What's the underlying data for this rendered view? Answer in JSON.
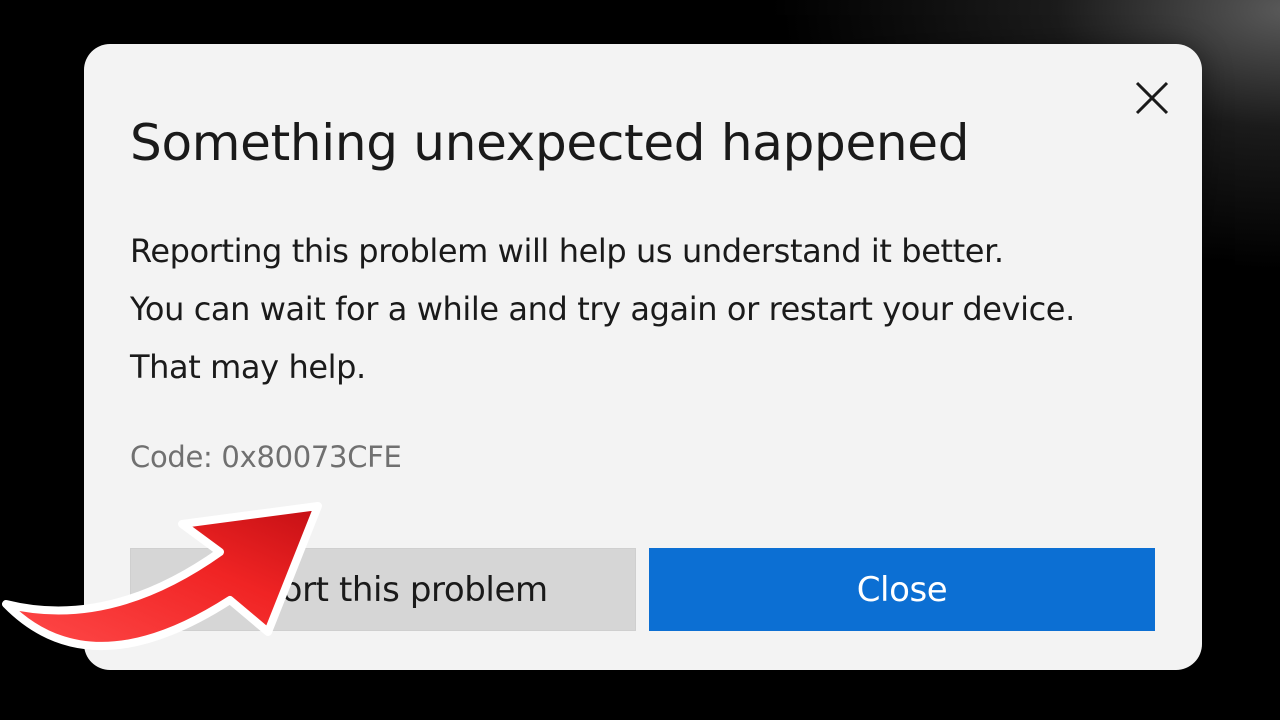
{
  "dialog": {
    "title": "Something unexpected happened",
    "message_lines": [
      "Reporting this problem will help us understand it better.",
      "You can wait for a while and try again or restart your device.",
      "That may help."
    ],
    "code_text": "Code: 0x80073CFE",
    "report_button_label": "Report this problem",
    "close_button_label": "Close",
    "close_icon": "close-x-icon"
  },
  "overlay": {
    "arrow_icon": "red-curved-arrow-icon",
    "arrow_color": "#e8191f"
  },
  "colors": {
    "accent": "#0c6fd3",
    "dialog_bg": "#f3f3f3",
    "secondary_button_bg": "#d6d6d6",
    "code_text": "#707070"
  }
}
